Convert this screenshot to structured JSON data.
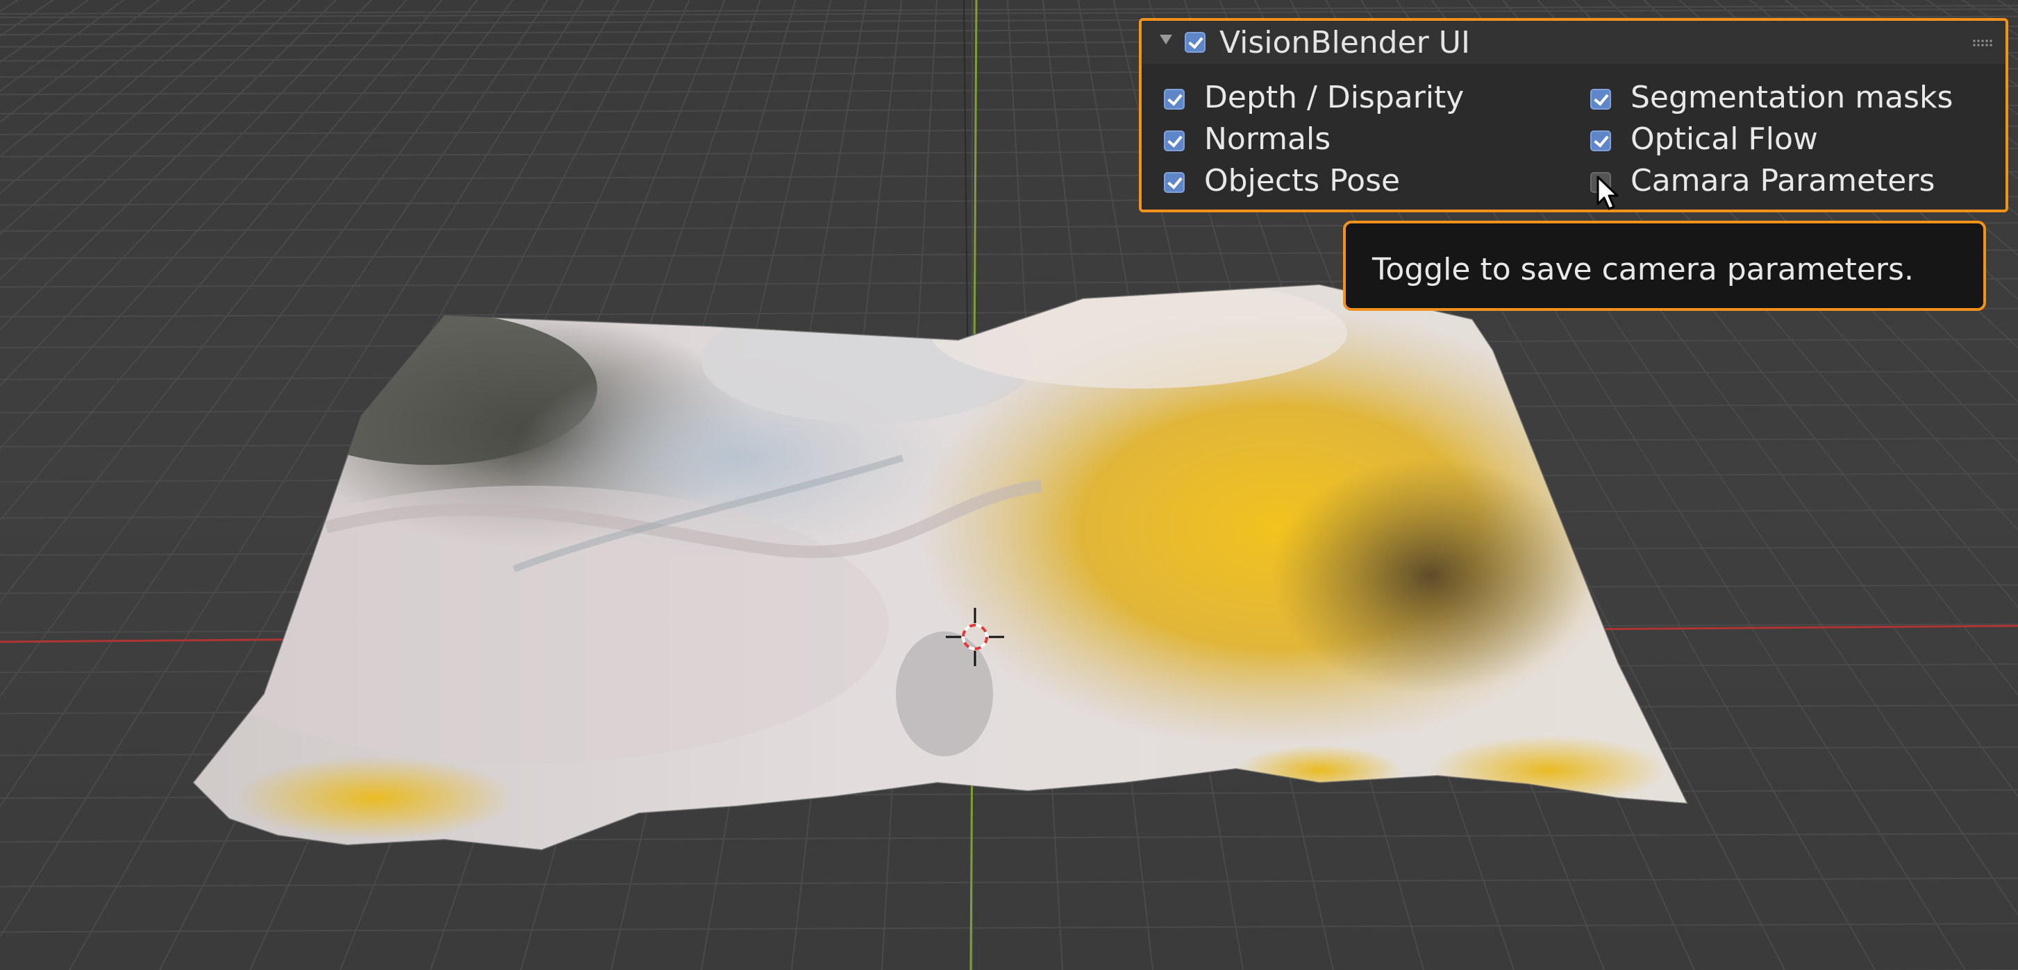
{
  "panel": {
    "title": "VisionBlender UI",
    "enabled": true,
    "options": [
      {
        "label": "Depth / Disparity",
        "checked": true
      },
      {
        "label": "Segmentation masks",
        "checked": true
      },
      {
        "label": "Normals",
        "checked": true
      },
      {
        "label": "Optical Flow",
        "checked": true
      },
      {
        "label": "Objects Pose",
        "checked": true
      },
      {
        "label": "Camara Parameters",
        "checked": false
      }
    ]
  },
  "tooltip": {
    "text": "Toggle to save camera parameters."
  },
  "icons": {
    "collapse": "triangle-down-icon",
    "grip": "drag-grip-icon",
    "mouse": "mouse-pointer-icon",
    "scene_cursor": "3d-cursor-icon"
  },
  "colors": {
    "accent": "#f2911c",
    "checkbox": "#5f86c8",
    "x_axis": "#c03636",
    "y_axis": "#7fa236"
  }
}
